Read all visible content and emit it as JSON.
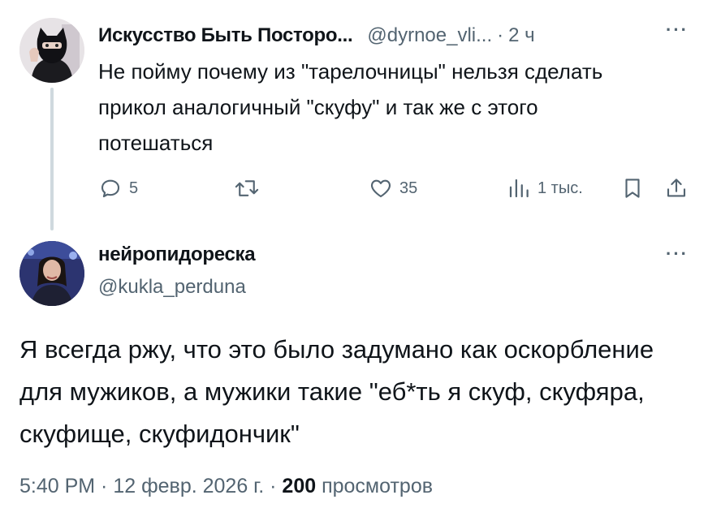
{
  "parent_tweet": {
    "author_name": "Искусство Быть Посторо...",
    "handle": "@dyrnoe_vli...",
    "separator": "·",
    "time": "2 ч",
    "more_label": "···",
    "text": "Не пойму почему из \"тарелочницы\" нельзя сделать\nприкол аналогичный \"скуфу\" и так же с этого\nпотешаться",
    "actions": {
      "replies": "5",
      "reposts": "",
      "likes": "35",
      "views": "1 тыс."
    }
  },
  "reply_tweet": {
    "author_name": "нейропидореска",
    "handle": "@kukla_perduna",
    "more_label": "···",
    "text": "Я всегда ржу, что это было задумано как оскорбление\nдля мужиков, а мужики такие \"еб*ть я скуф, скуфяра,\nскуфище, скуфидончик\"",
    "timestamp": "5:40 PM · 12 февр. 2026 г. · ",
    "views_count": "200",
    "views_label": " просмотров"
  }
}
